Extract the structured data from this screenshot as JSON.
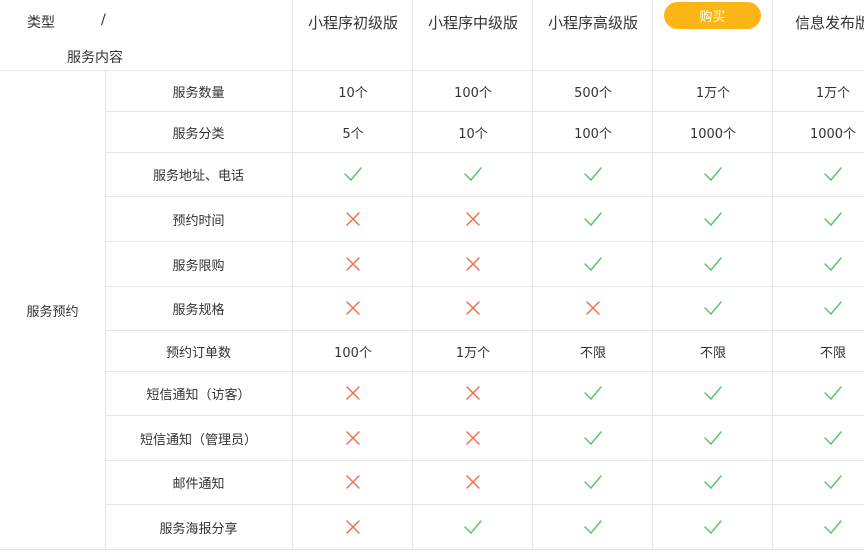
{
  "header": {
    "type_label": "类型",
    "slash": "/",
    "content_label": "服务内容",
    "plans": [
      "小程序初级版",
      "小程序中级版",
      "小程序高级版",
      "",
      "信息发布版"
    ],
    "buy_label": "购买"
  },
  "category_label": "服务预约",
  "colors": {
    "check": "#5cc56e",
    "cross": "#f07050",
    "buy": "#fbb615",
    "grid": "#e6e6e6"
  },
  "icons": {
    "check": "check-icon",
    "cross": "cross-icon"
  },
  "rows": [
    {
      "feature": "服务数量",
      "cells": [
        "10个",
        "100个",
        "500个",
        "1万个",
        "1万个"
      ]
    },
    {
      "feature": "服务分类",
      "cells": [
        "5个",
        "10个",
        "100个",
        "1000个",
        "1000个"
      ]
    },
    {
      "feature": "服务地址、电话",
      "cells": [
        "check",
        "check",
        "check",
        "check",
        "check"
      ]
    },
    {
      "feature": "预约时间",
      "cells": [
        "cross",
        "cross",
        "check",
        "check",
        "check"
      ]
    },
    {
      "feature": "服务限购",
      "cells": [
        "cross",
        "cross",
        "check",
        "check",
        "check"
      ]
    },
    {
      "feature": "服务规格",
      "cells": [
        "cross",
        "cross",
        "cross",
        "check",
        "check"
      ]
    },
    {
      "feature": "预约订单数",
      "cells": [
        "100个",
        "1万个",
        "不限",
        "不限",
        "不限"
      ]
    },
    {
      "feature": "短信通知（访客）",
      "cells": [
        "cross",
        "cross",
        "check",
        "check",
        "check"
      ]
    },
    {
      "feature": "短信通知（管理员）",
      "cells": [
        "cross",
        "cross",
        "check",
        "check",
        "check"
      ]
    },
    {
      "feature": "邮件通知",
      "cells": [
        "cross",
        "cross",
        "check",
        "check",
        "check"
      ]
    },
    {
      "feature": "服务海报分享",
      "cells": [
        "cross",
        "check",
        "check",
        "check",
        "check"
      ]
    }
  ]
}
